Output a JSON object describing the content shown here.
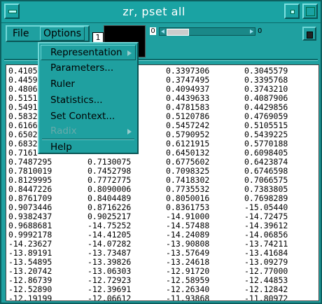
{
  "window": {
    "title": "zr, pset all"
  },
  "menubar": {
    "file": "File",
    "options": "Options"
  },
  "toolbar": {
    "frame_number": "1",
    "slider_min": "0",
    "slider_max": "0"
  },
  "dropdown": {
    "items": [
      {
        "label": "Representation",
        "enabled": true,
        "submenu": true
      },
      {
        "label": "Parameters...",
        "enabled": true,
        "submenu": false
      },
      {
        "label": "Ruler",
        "enabled": true,
        "submenu": false
      },
      {
        "label": "Statistics...",
        "enabled": true,
        "submenu": false
      },
      {
        "label": "Set Context...",
        "enabled": true,
        "submenu": false
      },
      {
        "label": "Radix",
        "enabled": false,
        "submenu": true
      },
      {
        "label": "Help",
        "enabled": true,
        "submenu": false
      }
    ]
  },
  "table": {
    "rows": [
      [
        "0.4105",
        "",
        "0.3397306",
        "0.3045579"
      ],
      [
        "0.4459",
        "",
        "0.3747495",
        "0.3395768"
      ],
      [
        "0.4806",
        "",
        "0.4094937",
        "0.3743210"
      ],
      [
        "0.5151",
        "",
        "0.4439633",
        "0.4087906"
      ],
      [
        "0.5491",
        "",
        "0.4781583",
        "0.4429856"
      ],
      [
        "0.5832",
        "",
        "0.5120786",
        "0.4769059"
      ],
      [
        "0.6166",
        "",
        "0.5457242",
        "0.5105515"
      ],
      [
        "0.6502",
        "",
        "0.5790952",
        "0.5439225"
      ],
      [
        "0.6832",
        "",
        "0.6121915",
        "0.5770188"
      ],
      [
        "0.7161",
        "",
        "0.6450132",
        "0.6098405"
      ],
      [
        "0.7487295",
        "0.7130075",
        "0.6775602",
        "0.6423874"
      ],
      [
        "0.7810019",
        "0.7452798",
        "0.7098325",
        "0.6746598"
      ],
      [
        "0.8129995",
        "0.7772775",
        "0.7418302",
        "0.7066575"
      ],
      [
        "0.8447226",
        "0.8090006",
        "0.7735532",
        "0.7383805"
      ],
      [
        "0.8761709",
        "0.8404489",
        "0.8050016",
        "0.7698289"
      ],
      [
        "0.9073446",
        "0.8716226",
        "0.8361753",
        "-15.05440"
      ],
      [
        "0.9382437",
        "0.9025217",
        "-14.91000",
        "-14.72475"
      ],
      [
        "0.9688681",
        "-14.75252",
        "-14.57488",
        "-14.39612"
      ],
      [
        "0.9992178",
        "-14.41205",
        "-14.24089",
        "-14.06856"
      ],
      [
        "-14.23627",
        "-14.07282",
        "-13.90808",
        "-13.74211"
      ],
      [
        "-13.89191",
        "-13.73487",
        "-13.57649",
        "-13.41684"
      ],
      [
        "-13.54895",
        "-13.39826",
        "-13.24618",
        "-13.09279"
      ],
      [
        "-13.20742",
        "-13.06303",
        "-12.91720",
        "-12.77000"
      ],
      [
        "-12.86739",
        "-12.72923",
        "-12.58959",
        "-12.44853"
      ],
      [
        "-12.52890",
        "-12.39691",
        "-12.26340",
        "-12.12842"
      ],
      [
        "-12.19199",
        "-12.06612",
        "-11.93868",
        "-11.80972"
      ]
    ]
  }
}
